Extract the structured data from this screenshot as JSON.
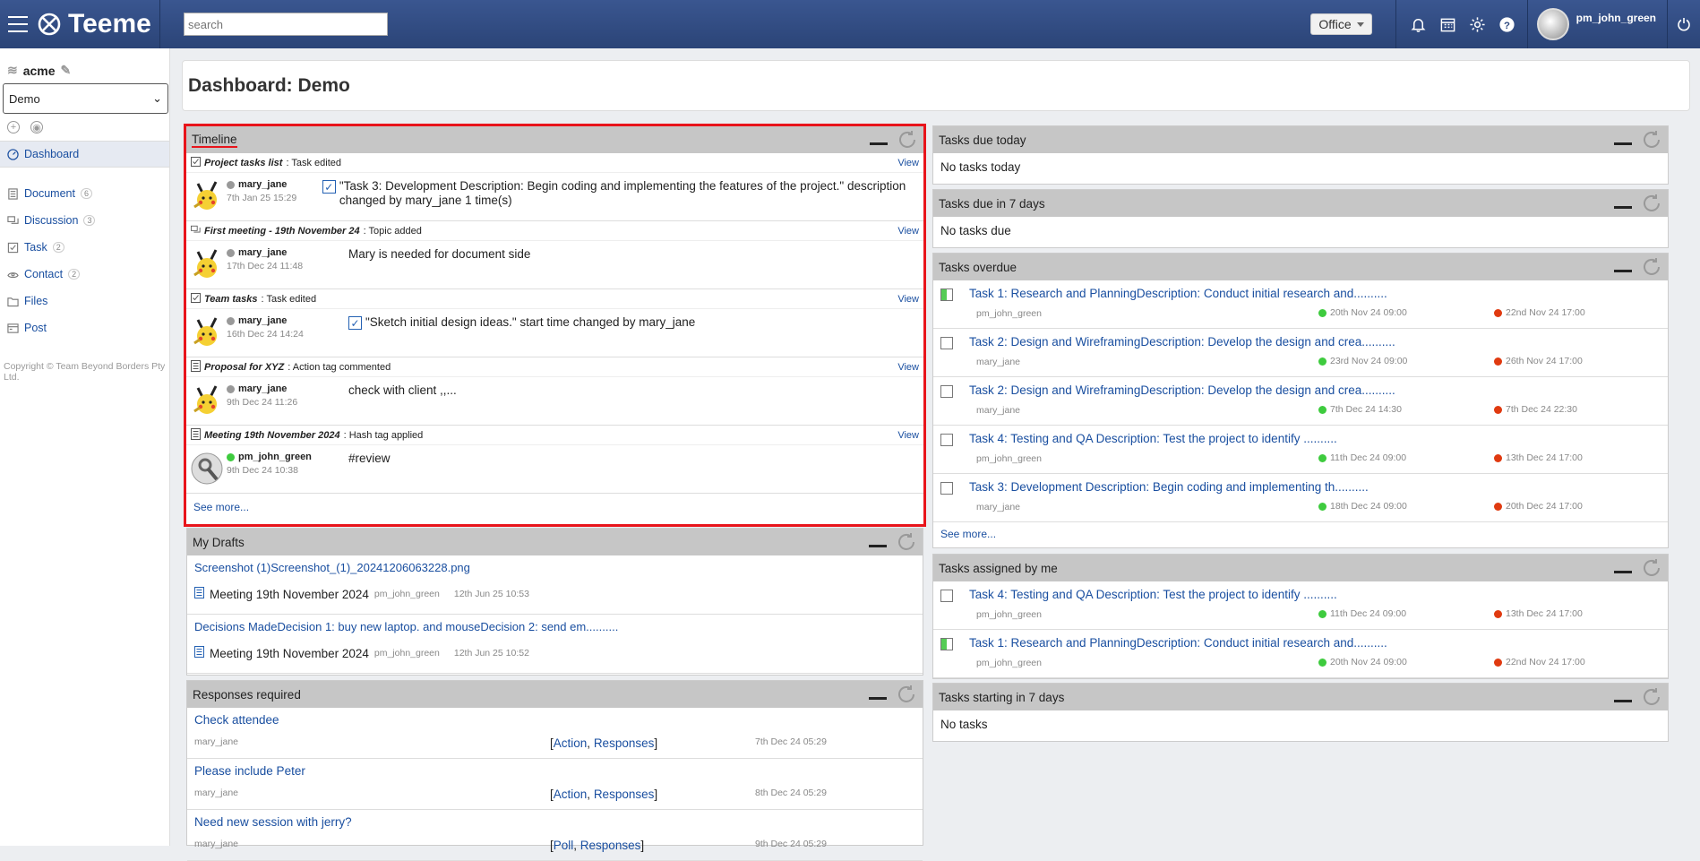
{
  "app": {
    "name": "Teeme",
    "search_placeholder": "search",
    "office_label": "Office",
    "user_name": "pm_john_green"
  },
  "sidebar": {
    "workspace": "acme",
    "selected_space": "Demo",
    "items": [
      {
        "label": "Dashboard",
        "count": "",
        "icon": "dashboard-icon",
        "active": true
      },
      {
        "label": "Document",
        "count": "6",
        "icon": "document-icon"
      },
      {
        "label": "Discussion",
        "count": "3",
        "icon": "discussion-icon"
      },
      {
        "label": "Task",
        "count": "2",
        "icon": "task-icon"
      },
      {
        "label": "Contact",
        "count": "2",
        "icon": "contact-icon"
      },
      {
        "label": "Files",
        "count": "",
        "icon": "folder-icon"
      },
      {
        "label": "Post",
        "count": "",
        "icon": "post-icon"
      }
    ],
    "copyright": "Copyright © Team Beyond Borders Pty Ltd."
  },
  "page": {
    "title": "Dashboard: Demo"
  },
  "timeline": {
    "title": "Timeline",
    "view_label": "View",
    "see_more": "See more...",
    "items": [
      {
        "source": "Project tasks list",
        "action": ": Task edited",
        "user": "mary_jane",
        "time": "7th Jan 25 15:29",
        "message": "\"Task 3: Development Description: Begin coding and implementing the features of the project.\" description changed by mary_jane 1 time(s)",
        "status": "grey"
      },
      {
        "source": "First meeting - 19th November 24",
        "action": ": Topic added",
        "user": "mary_jane",
        "time": "17th Dec 24 11:48",
        "message": "Mary is needed for document side",
        "status": "grey"
      },
      {
        "source": "Team tasks",
        "action": ": Task edited",
        "user": "mary_jane",
        "time": "16th Dec 24 14:24",
        "message": "\"Sketch initial design ideas.\" start time changed by mary_jane",
        "status": "grey"
      },
      {
        "source": "Proposal for XYZ",
        "action": ": Action tag commented",
        "user": "mary_jane",
        "time": "9th Dec 24 11:26",
        "message": "check with client ,,...",
        "status": "grey"
      },
      {
        "source": "Meeting 19th November 2024",
        "action": ": Hash tag applied",
        "user": "pm_john_green",
        "time": "9th Dec 24 10:38",
        "message": "#review",
        "status": "green"
      }
    ]
  },
  "drafts": {
    "title": "My Drafts",
    "items": [
      {
        "link": "Screenshot (1)Screenshot_(1)_20241206063228.png",
        "doc": "Meeting 19th November 2024",
        "user": "pm_john_green",
        "time": "12th Jun 25 10:53"
      },
      {
        "link": "Decisions MadeDecision 1: buy new laptop. and mouseDecision 2: send em..........",
        "doc": "Meeting 19th November 2024",
        "user": "pm_john_green",
        "time": "12th Jun 25 10:52"
      }
    ]
  },
  "responses": {
    "title": "Responses required",
    "items": [
      {
        "link": "Check attendee",
        "user": "mary_jane",
        "tag1": "Action",
        "tag2": "Responses",
        "time": "7th Dec 24 05:29"
      },
      {
        "link": "Please include Peter",
        "user": "mary_jane",
        "tag1": "Action",
        "tag2": "Responses",
        "time": "8th Dec 24 05:29"
      },
      {
        "link": "Need new session with jerry?",
        "user": "mary_jane",
        "tag1": "Poll",
        "tag2": "Responses",
        "time": "9th Dec 24 05:29"
      }
    ]
  },
  "tasks_today": {
    "title": "Tasks due today",
    "empty": "No tasks today"
  },
  "tasks_7days": {
    "title": "Tasks due in 7 days",
    "empty": "No tasks due"
  },
  "tasks_overdue": {
    "title": "Tasks overdue",
    "see_more": "See more...",
    "items": [
      {
        "title": "Task 1: Research and PlanningDescription: Conduct initial research and..........",
        "user": "pm_john_green",
        "start": "20th Nov 24 09:00",
        "end": "22nd Nov 24 17:00",
        "progress": 0.5
      },
      {
        "title": "Task 2: Design and WireframingDescription: Develop the design and crea..........",
        "user": "mary_jane",
        "start": "23rd Nov 24 09:00",
        "end": "26th Nov 24 17:00",
        "progress": 0
      },
      {
        "title": "Task 2: Design and WireframingDescription: Develop the design and crea..........",
        "user": "mary_jane",
        "start": "7th Dec 24 14:30",
        "end": "7th Dec 24 22:30",
        "progress": 0
      },
      {
        "title": "Task 4: Testing and QA Description: Test the project to identify ..........",
        "user": "pm_john_green",
        "start": "11th Dec 24 09:00",
        "end": "13th Dec 24 17:00",
        "progress": 0
      },
      {
        "title": "Task 3: Development Description: Begin coding and implementing th..........",
        "user": "mary_jane",
        "start": "18th Dec 24 09:00",
        "end": "20th Dec 24 17:00",
        "progress": 0
      }
    ]
  },
  "tasks_assigned": {
    "title": "Tasks assigned by me",
    "items": [
      {
        "title": "Task 4: Testing and QA Description: Test the project to identify ..........",
        "user": "pm_john_green",
        "start": "11th Dec 24 09:00",
        "end": "13th Dec 24 17:00",
        "progress": 0
      },
      {
        "title": "Task 1: Research and PlanningDescription: Conduct initial research and..........",
        "user": "pm_john_green",
        "start": "20th Nov 24 09:00",
        "end": "22nd Nov 24 17:00",
        "progress": 0.5
      }
    ]
  },
  "tasks_starting": {
    "title": "Tasks starting in 7 days",
    "empty": "No tasks"
  },
  "colors": {
    "topbar": "#2f4a80",
    "link": "#1a4fa0",
    "highlight_border": "#e8141b",
    "panel_header": "#c6c6c6",
    "status_green": "#3ecb3e",
    "status_red": "#e03a10"
  }
}
